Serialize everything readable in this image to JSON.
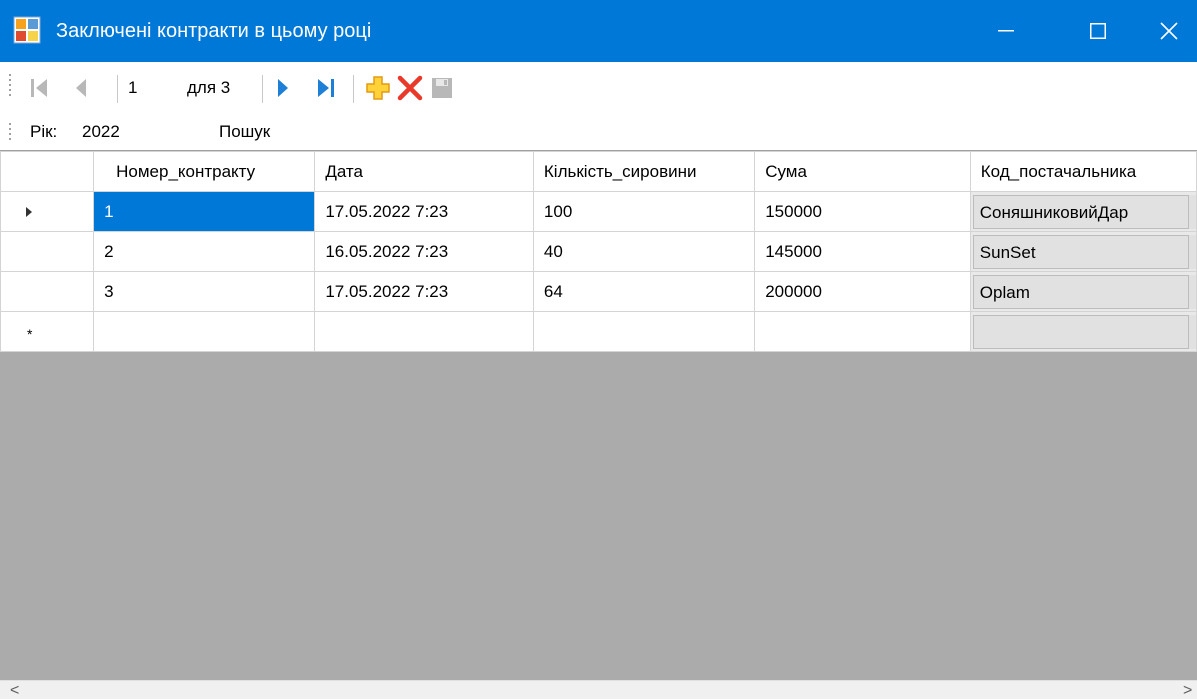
{
  "window": {
    "title": "Заключені контракти в цьому році",
    "accent_color": "#0078d7"
  },
  "navigator": {
    "position": "1",
    "count_label": "для 3",
    "icons": [
      "move-first-icon",
      "move-previous-icon",
      "move-next-icon",
      "move-last-icon",
      "add-new-icon",
      "delete-icon",
      "save-icon"
    ]
  },
  "filter": {
    "year_label": "Рік:",
    "year_value": "2022",
    "search_label": "Пошук"
  },
  "grid": {
    "columns": [
      "Номер_контракту",
      "Дата",
      "Кількість_сировини",
      "Сума",
      "Код_постачальника"
    ],
    "rows": [
      {
        "number": "1",
        "date": "17.05.2022 7:23",
        "quantity": "100",
        "sum": "150000",
        "supplier": "СоняшниковийДар"
      },
      {
        "number": "2",
        "date": "16.05.2022 7:23",
        "quantity": "40",
        "sum": "145000",
        "supplier": "SunSet"
      },
      {
        "number": "3",
        "date": "17.05.2022 7:23",
        "quantity": "64",
        "sum": "200000",
        "supplier": "Oplam"
      }
    ],
    "new_row_marker": "*",
    "current_row_marker": "▶"
  },
  "scrollbar": {
    "left_arrow": "<",
    "right_arrow": ">"
  }
}
